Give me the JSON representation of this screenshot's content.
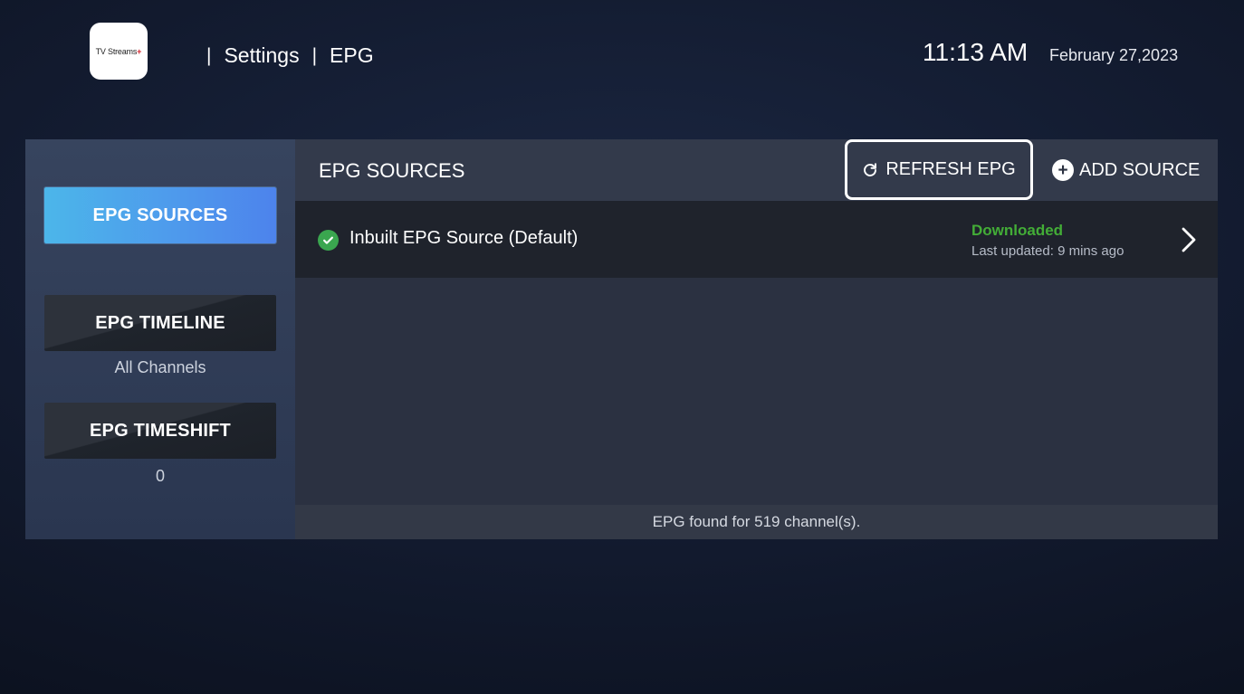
{
  "header": {
    "logo_text": "TV Streams",
    "logo_accent": "+",
    "breadcrumb": [
      "Settings",
      "EPG"
    ],
    "time": "11:13 AM",
    "date": "February 27,2023"
  },
  "sidebar": {
    "items": [
      {
        "label": "EPG SOURCES",
        "sub": "",
        "active": true
      },
      {
        "label": "EPG TIMELINE",
        "sub": "All Channels",
        "active": false
      },
      {
        "label": "EPG TIMESHIFT",
        "sub": "0",
        "active": false
      }
    ]
  },
  "main": {
    "title": "EPG SOURCES",
    "refresh_label": "REFRESH EPG",
    "add_label": "ADD SOURCE",
    "sources": [
      {
        "name": "Inbuilt EPG Source (Default)",
        "status": "Downloaded",
        "updated": "Last updated: 9 mins ago"
      }
    ],
    "footer": "EPG found for 519 channel(s)."
  },
  "colors": {
    "accent_active": "#4d8fec",
    "status_ok": "#43ad37",
    "check_green": "#3aa64f",
    "logo_accent": "#d2232a"
  },
  "icons": [
    "refresh-icon",
    "plus-circle-icon",
    "check-circle-icon",
    "chevron-right-icon"
  ]
}
